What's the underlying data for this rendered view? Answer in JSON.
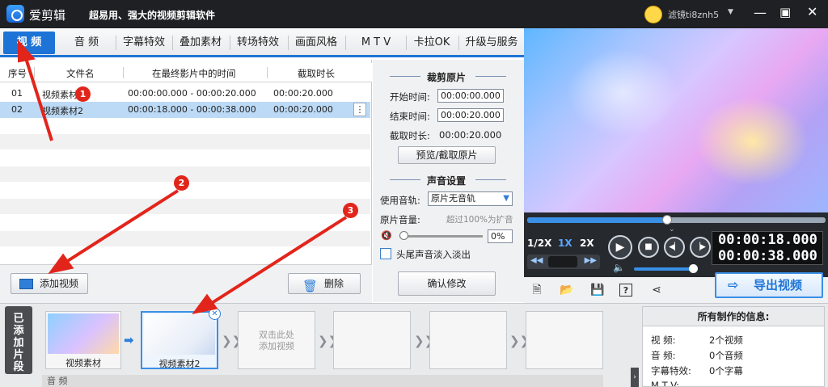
{
  "app": {
    "name": "爱剪辑",
    "slogan": "超易用、强大的视频剪辑软件",
    "username": "滤镜ti8znh5"
  },
  "tabs": [
    "视 频",
    "音 频",
    "字幕特效",
    "叠加素材",
    "转场特效",
    "画面风格",
    "M T V",
    "卡拉OK",
    "升级与服务"
  ],
  "table": {
    "headers": [
      "序号",
      "文件名",
      "在最终影片中的时间",
      "截取时长"
    ],
    "rows": [
      {
        "index": "01",
        "name": "视频素材1",
        "range": "00:00:00.000 - 00:00:20.000",
        "duration": "00:00:20.000"
      },
      {
        "index": "02",
        "name": "视频素材2",
        "range": "00:00:18.000 - 00:00:38.000",
        "duration": "00:00:20.000"
      }
    ],
    "menu_glyph": "⋮"
  },
  "buttons": {
    "add_video": "添加视频",
    "delete": "删除",
    "preview_cut": "预览/截取原片",
    "confirm": "确认修改",
    "export": "导出视频"
  },
  "cut": {
    "title": "裁剪原片",
    "start_label": "开始时间:",
    "start_value": "00:00:00.000",
    "end_label": "结束时间:",
    "end_value": "00:00:20.000",
    "duration_label": "截取时长:",
    "duration_value": "00:00:20.000"
  },
  "sound": {
    "title": "声音设置",
    "track_label": "使用音轨:",
    "track_value": "原片无音轨",
    "volume_label": "原片音量:",
    "volume_hint": "超过100%为扩音",
    "volume_value": "0%",
    "fade_label": "头尾声音淡入淡出"
  },
  "player": {
    "progress": 0.47,
    "speeds": [
      "1/2X",
      "1X",
      "2X"
    ],
    "time_current": "00:00:18.000",
    "time_total": "00:00:38.000",
    "volume": 1.0
  },
  "timeline": {
    "side_label": "已添加片段",
    "clips": [
      "视频素材",
      "视频素材2"
    ],
    "placeholder": "双击此处\n添加视频",
    "audio_label": "音 频"
  },
  "info": {
    "title": "所有制作的信息:",
    "rows": [
      {
        "label": "视    频:",
        "value": "2个视频"
      },
      {
        "label": "音    频:",
        "value": "0个音频"
      },
      {
        "label": "字幕特效:",
        "value": "0个字幕"
      },
      {
        "label": "M T V:",
        "value": ""
      }
    ]
  },
  "annotations": [
    "1",
    "2",
    "3"
  ],
  "colors": {
    "accent": "#1d74d6",
    "annotation": "#e2251b",
    "titlebar": "#1f2024"
  }
}
